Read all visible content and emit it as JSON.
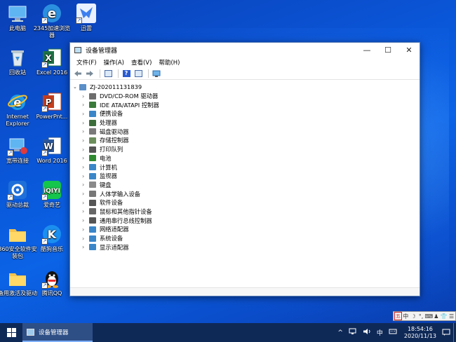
{
  "desktop": {
    "icons": [
      {
        "label": "此电脑"
      },
      {
        "label": "2345加速浏览器"
      },
      {
        "label": "迅雷"
      },
      {
        "label": "回收站"
      },
      {
        "label": "Excel 2016"
      },
      {
        "label": "Internet Explorer"
      },
      {
        "label": "PowerPnt..."
      },
      {
        "label": "宽带连接"
      },
      {
        "label": "Word 2016"
      },
      {
        "label": "驱动总裁"
      },
      {
        "label": "爱奇艺"
      },
      {
        "label": "360安全软件安装包"
      },
      {
        "label": "酷狗音乐"
      },
      {
        "label": "备用激活及驱动"
      },
      {
        "label": "腾讯QQ"
      }
    ]
  },
  "window": {
    "title": "设备管理器",
    "controls": {
      "minimize": "—",
      "maximize": "☐",
      "close": "✕"
    },
    "menu": [
      "文件(F)",
      "操作(A)",
      "查看(V)",
      "帮助(H)"
    ],
    "tree": {
      "root": "ZJ-202011131839",
      "children": [
        {
          "label": "DVD/CD-ROM 驱动器",
          "color": "#6d6d6d"
        },
        {
          "label": "IDE ATA/ATAPI 控制器",
          "color": "#3a7a3a"
        },
        {
          "label": "便携设备",
          "color": "#3a86c8"
        },
        {
          "label": "处理器",
          "color": "#3c6e3c"
        },
        {
          "label": "磁盘驱动器",
          "color": "#7a7a7a"
        },
        {
          "label": "存储控制器",
          "color": "#6c8e5c"
        },
        {
          "label": "打印队列",
          "color": "#555555"
        },
        {
          "label": "电池",
          "color": "#2f8a2f"
        },
        {
          "label": "计算机",
          "color": "#3a86c8"
        },
        {
          "label": "监视器",
          "color": "#3a86c8"
        },
        {
          "label": "键盘",
          "color": "#8a8a8a"
        },
        {
          "label": "人体学输入设备",
          "color": "#777777"
        },
        {
          "label": "软件设备",
          "color": "#555555"
        },
        {
          "label": "鼠标和其他指针设备",
          "color": "#666666"
        },
        {
          "label": "通用串行总线控制器",
          "color": "#555555"
        },
        {
          "label": "网络适配器",
          "color": "#3a86c8"
        },
        {
          "label": "系统设备",
          "color": "#3a86c8"
        },
        {
          "label": "显示适配器",
          "color": "#3a86c8"
        }
      ]
    }
  },
  "langbar": {
    "items": [
      "五",
      "中",
      "☽",
      "°,",
      "⌨",
      "♟",
      "👕",
      "☰"
    ]
  },
  "taskbar": {
    "active_task": "设备管理器",
    "tray": {
      "chevron": "^",
      "ime": "中",
      "time": "18:54:16",
      "date": "2020/11/13"
    }
  }
}
